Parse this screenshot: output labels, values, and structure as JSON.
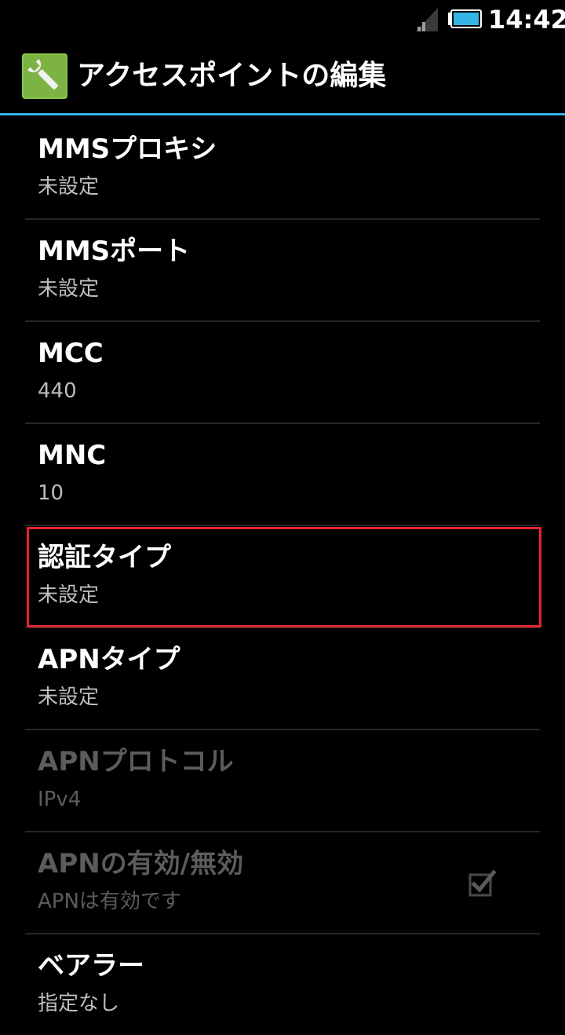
{
  "status_bar": {
    "time": "14:42",
    "icons": [
      "signal-icon",
      "battery-icon"
    ]
  },
  "action_bar": {
    "title": "アクセスポイントの編集",
    "icon": "wrench-settings-icon"
  },
  "colors": {
    "accent": "#33b5e5",
    "highlight": "#e4262f",
    "app_icon_green": "#8bc34a"
  },
  "settings": [
    {
      "title": "MMSプロキシ",
      "summary": "未設定",
      "enabled": true
    },
    {
      "title": "MMSポート",
      "summary": "未設定",
      "enabled": true
    },
    {
      "title": "MCC",
      "summary": "440",
      "enabled": true
    },
    {
      "title": "MNC",
      "summary": "10",
      "enabled": true
    },
    {
      "title": "認証タイプ",
      "summary": "未設定",
      "enabled": true,
      "highlighted": true
    },
    {
      "title": "APNタイプ",
      "summary": "未設定",
      "enabled": true
    },
    {
      "title": "APNプロトコル",
      "summary": "IPv4",
      "enabled": false
    },
    {
      "title": "APNの有効/無効",
      "summary": "APNは有効です",
      "enabled": false,
      "checkbox": true,
      "checked": true
    },
    {
      "title": "ベアラー",
      "summary": "指定なし",
      "enabled": true
    }
  ]
}
